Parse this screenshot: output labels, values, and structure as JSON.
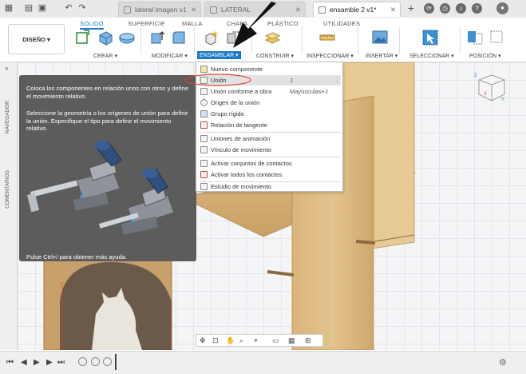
{
  "tabs": {
    "items": [
      {
        "label": "lateral imagen v1"
      },
      {
        "label": "LATERAL"
      },
      {
        "label": "ensamble 2 v1*"
      }
    ]
  },
  "toolbar": {
    "workspace_label": "DISEÑO ▾",
    "ribbon_tabs": [
      "SOLIDO",
      "SUPERFICIE",
      "MALLA",
      "CHAPA",
      "PLÁSTICO",
      "UTILIDADES"
    ],
    "groups": {
      "crear": "CREAR ▾",
      "modificar": "MODIFICAR ▾",
      "ensamblar": "ENSAMBLAR ▾",
      "construir": "CONSTRUIR ▾",
      "inspeccionar": "INSPECCIONAR ▾",
      "insertar": "INSERTAR ▾",
      "seleccionar": "SELECCIONAR ▾",
      "posicion": "POSICIÓN ▾"
    }
  },
  "sidebar": {
    "expand": "»",
    "navegador": "NAVEGADOR",
    "comentarios": "COMENTARIOS"
  },
  "tooltip": {
    "description": "Coloca los componentes en relación unos con otros y define el movimiento relativo.",
    "instruction": "Seleccione la geometría o los orígenes de unión para definir la unión. Especifique el tipo para definir el movimiento relativo.",
    "footer": "Pulse Ctrl+/ para obtener más ayuda."
  },
  "menu": {
    "items": [
      {
        "label": "Nuevo componente",
        "key": ""
      },
      {
        "label": "Unión",
        "key": "J"
      },
      {
        "label": "Unión conforme a obra",
        "key": "Mayúsculas+J"
      },
      {
        "label": "Origen de la unión",
        "key": ""
      },
      {
        "label": "Grupo rígido",
        "key": ""
      },
      {
        "label": "Relación de tangente",
        "key": ""
      },
      {
        "label": "Uniones de animación",
        "key": ""
      },
      {
        "label": "Vínculo de movimiento",
        "key": ""
      },
      {
        "label": "Activar conjuntos de contactos",
        "key": ""
      },
      {
        "label": "Activar todos los contactos",
        "key": ""
      },
      {
        "label": "Estudio de movimiento",
        "key": ""
      }
    ]
  },
  "viewcube": {
    "face": "FRONT",
    "axis_z": "Z",
    "axis_x": "X",
    "axis_y": "Y"
  },
  "colors": {
    "accent": "#1b7ac5",
    "highlight_ring": "#e0403a",
    "wood": "#d9b57c",
    "tooltip_bg": "#5c5c5c"
  }
}
